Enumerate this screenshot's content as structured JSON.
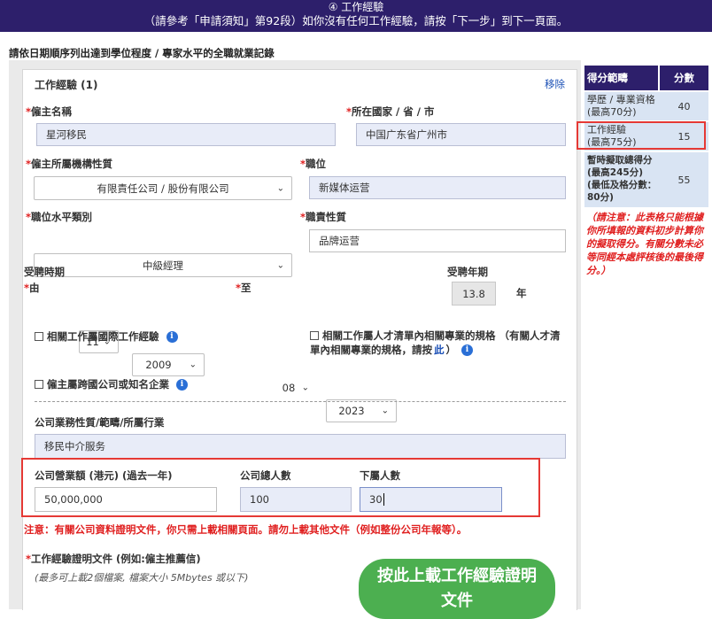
{
  "header": {
    "title": "④ 工作經驗",
    "subtitle": "（請參考「申請須知」第92段）如你沒有任何工作經驗，請按「下一步」到下一頁面。"
  },
  "intro": "請依日期順序列出達到學位程度 / 專家水平的全職就業記錄",
  "work": {
    "title": "工作經驗 (1)",
    "remove": "移除",
    "employer_label": "僱主名稱",
    "employer_value": "星河移民",
    "location_label": "所在國家 / 省 / 市",
    "location_value": "中国广东省广州市",
    "org_type_label": "僱主所屬機構性質",
    "org_type_value": "有限責任公司 / 股份有限公司",
    "position_label": "職位",
    "position_value": "新媒体运营",
    "level_label": "職位水平類別",
    "level_value": "中級經理",
    "duty_label": "職責性質",
    "duty_value": "品牌运营",
    "period_label": "受聘時期",
    "from_label": "由",
    "from_month": "11",
    "from_year": "2009",
    "to_label": "至",
    "to_month": "08",
    "to_year": "2023",
    "years_label": "受聘年期",
    "years_value": "13.8",
    "years_unit": "年",
    "intl_label": "相關工作屬國際工作經驗",
    "talent_label_1": "相關工作屬人才清單內相關專業的規格 （有關人才清",
    "talent_label_2a": "單內相關專業的規格，請按",
    "talent_link": "此",
    "talent_label_2b": "）",
    "mnc_label": "僱主屬跨國公司或知名企業",
    "business_label": "公司業務性質/範疇/所屬行業",
    "business_value": "移民中介服务",
    "turnover_label": "公司營業額 (港元) (過去一年)",
    "turnover_value": "50,000,000",
    "staff_label": "公司總人數",
    "staff_value": "100",
    "sub_label": "下屬人數",
    "sub_value": "30",
    "warning": "注意：有關公司資料證明文件，你只需上載相關頁面。請勿上載其他文件（例如整份公司年報等）。",
    "proof_label": "工作經驗證明文件 (例如:僱主推薦信)",
    "proof_hint": "(最多可上載2個檔案, 檔案大小 5Mbytes 或以下)",
    "upload_button_1": "按此上載工作經驗證明",
    "upload_button_2": "文件"
  },
  "score": {
    "col1": "得分範疇",
    "col2": "分數",
    "rows": [
      {
        "l1": "學歷 / 專業資格",
        "l2": "(最高70分)",
        "value": "40"
      },
      {
        "l1": "工作經驗",
        "l2": "(最高75分)",
        "value": "15"
      },
      {
        "l1": "暫時擬取總得分",
        "l2": "(最高245分)",
        "l3": "(最低及格分數：",
        "l4": "80分)",
        "value": "55"
      }
    ],
    "note": "（請注意：此表格只能根據你所填報的資料初步計算你的擬取得分。有關分數未必等同經本處評核後的最後得分。）"
  },
  "colors": {
    "header": "#2d1f6b",
    "accent_red": "#e53935",
    "button_green": "#4caf50",
    "link_blue": "#1a4fb5"
  }
}
